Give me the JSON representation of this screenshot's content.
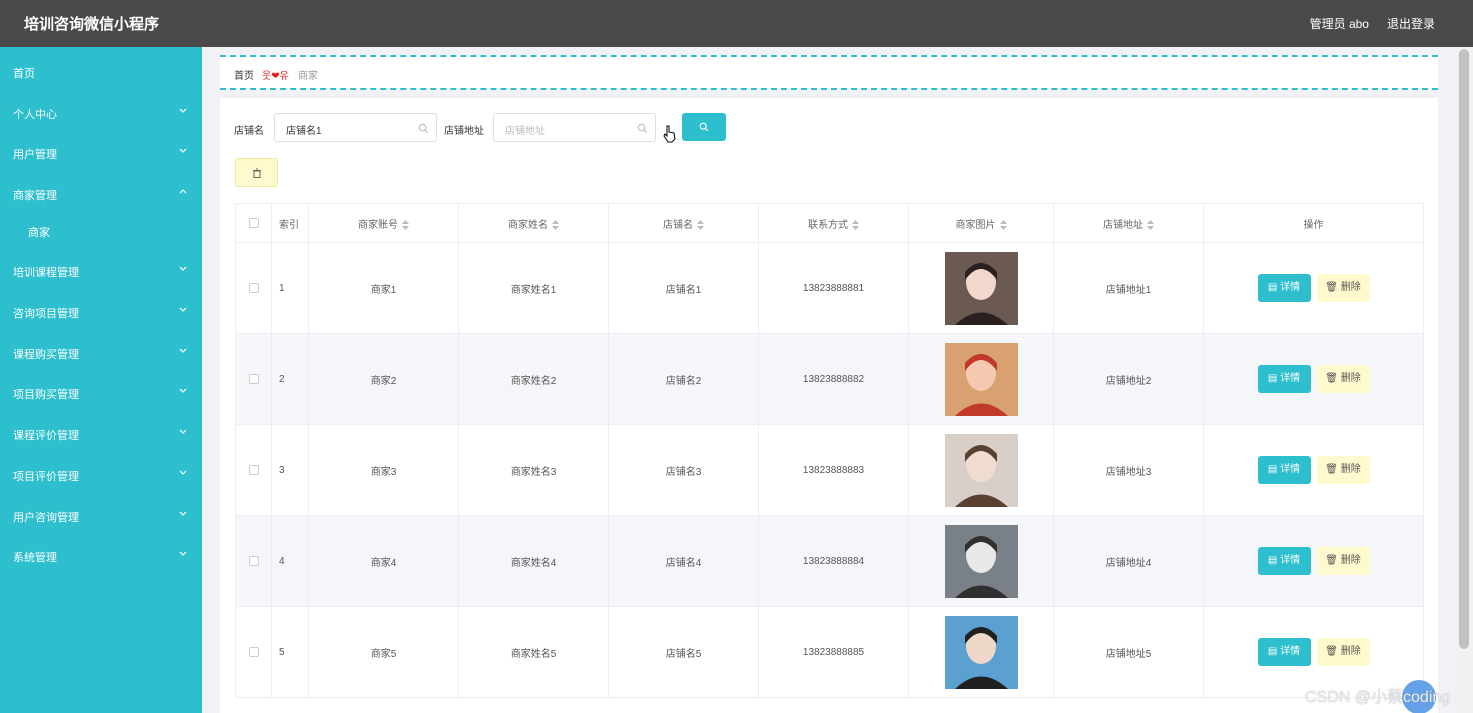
{
  "app": {
    "title": "培训咨询微信小程序",
    "admin_label": "管理员 abo",
    "logout": "退出登录"
  },
  "sidebar": {
    "items": [
      {
        "label": "首页",
        "arrow": "none"
      },
      {
        "label": "个人中心",
        "arrow": "down"
      },
      {
        "label": "用户管理",
        "arrow": "down"
      },
      {
        "label": "商家管理",
        "arrow": "up"
      },
      {
        "label": "商家",
        "arrow": "none"
      },
      {
        "label": "培训课程管理",
        "arrow": "down"
      },
      {
        "label": "咨询项目管理",
        "arrow": "down"
      },
      {
        "label": "课程购买管理",
        "arrow": "down"
      },
      {
        "label": "项目购买管理",
        "arrow": "down"
      },
      {
        "label": "课程评价管理",
        "arrow": "down"
      },
      {
        "label": "项目评价管理",
        "arrow": "down"
      },
      {
        "label": "用户咨询管理",
        "arrow": "down"
      },
      {
        "label": "系统管理",
        "arrow": "down"
      }
    ]
  },
  "breadcrumb": {
    "home": "首页",
    "heart": "웃❤유",
    "current": "商家"
  },
  "search": {
    "shop_name_label": "店铺名",
    "shop_name_value": "店铺名1",
    "shop_addr_label": "店铺地址",
    "shop_addr_placeholder": "店铺地址"
  },
  "table": {
    "headers": [
      "索引",
      "商家账号",
      "商家姓名",
      "店铺名",
      "联系方式",
      "商家图片",
      "店铺地址",
      "操作"
    ],
    "detail_label": "详情",
    "delete_label": "删除",
    "rows": [
      {
        "idx": "1",
        "account": "商家1",
        "name": "商家姓名1",
        "shop": "店铺名1",
        "phone": "13823888881",
        "addr": "店铺地址1"
      },
      {
        "idx": "2",
        "account": "商家2",
        "name": "商家姓名2",
        "shop": "店铺名2",
        "phone": "13823888882",
        "addr": "店铺地址2"
      },
      {
        "idx": "3",
        "account": "商家3",
        "name": "商家姓名3",
        "shop": "店铺名3",
        "phone": "13823888883",
        "addr": "店铺地址3"
      },
      {
        "idx": "4",
        "account": "商家4",
        "name": "商家姓名4",
        "shop": "店铺名4",
        "phone": "13823888884",
        "addr": "店铺地址4"
      },
      {
        "idx": "5",
        "account": "商家5",
        "name": "商家姓名5",
        "shop": "店铺名5",
        "phone": "13823888885",
        "addr": "店铺地址5"
      }
    ]
  },
  "watermark": "CSDN @小蔡coding",
  "colors": {
    "accent": "#2dbfcd",
    "topbar": "#4a4a4a",
    "delete_bg": "#fffacd"
  }
}
